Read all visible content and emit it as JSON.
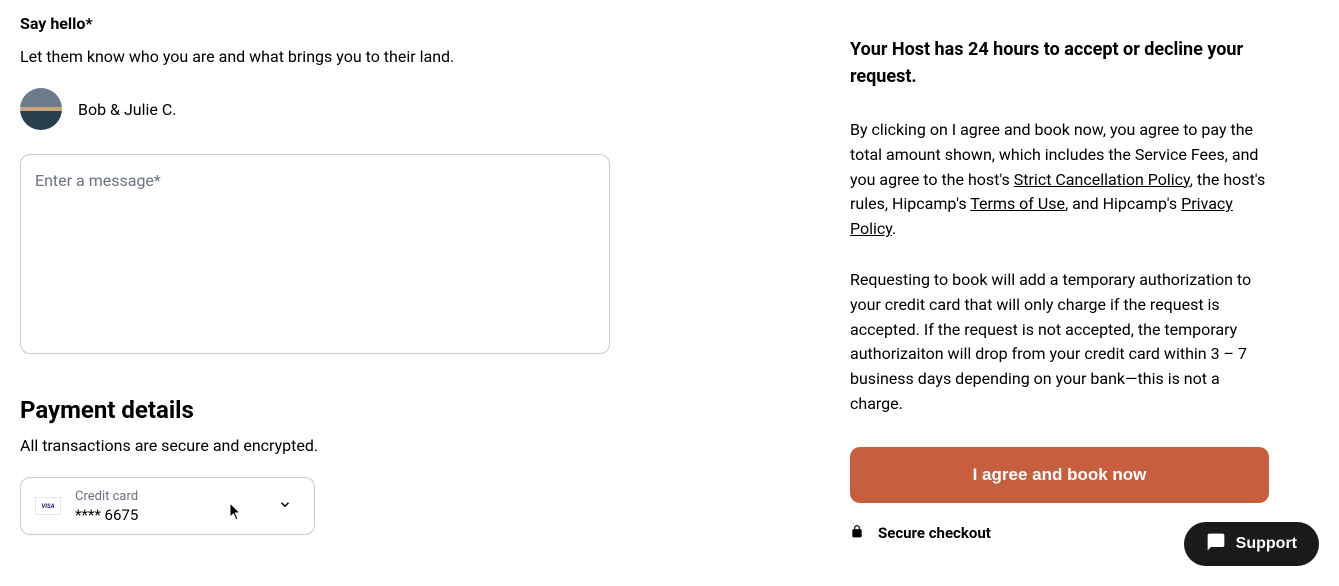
{
  "say_hello": {
    "title": "Say hello*",
    "subtitle": "Let them know who you are and what brings you to their land."
  },
  "host": {
    "name": "Bob & Julie C."
  },
  "message": {
    "placeholder": "Enter a message*"
  },
  "payment": {
    "title": "Payment details",
    "subtitle": "All transactions are secure and encrypted.",
    "card_label": "Credit card",
    "card_number": "**** 6675",
    "card_brand": "VISA"
  },
  "right_panel": {
    "deadline": "Your Host has 24 hours to accept or decline your request.",
    "terms_prefix": "By clicking on I agree and book now, you agree to pay the total amount shown, which includes the Service Fees, and you agree to the host's ",
    "strict_policy": "Strict Cancellation Policy",
    "terms_mid1": ", the host's rules, Hipcamp's ",
    "terms_of_use": "Terms of Use",
    "terms_mid2": ", and Hipcamp's ",
    "privacy_policy": "Privacy Policy",
    "terms_end": ".",
    "auth_text": "Requesting to book will add a temporary authorization to your credit card that will only charge if the request is accepted. If the request is not accepted, the temporary authorizaiton will drop from your credit card within 3 – 7 business days depending on your bank—this is not a charge.",
    "book_button": "I agree and book now",
    "secure_checkout": "Secure checkout"
  },
  "support": {
    "label": "Support"
  }
}
